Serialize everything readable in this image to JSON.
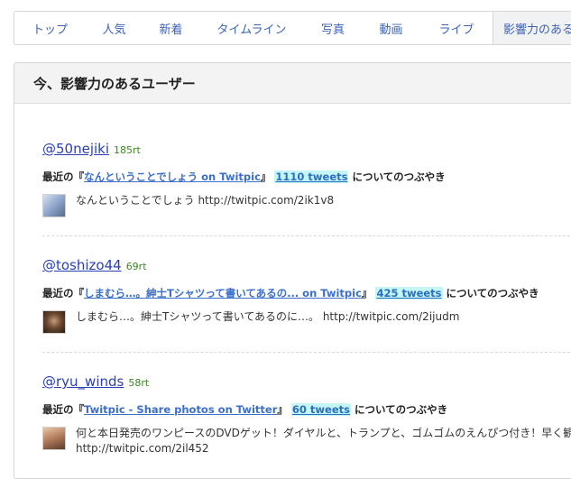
{
  "tabs": [
    {
      "label": "トップ"
    },
    {
      "label": "人気"
    },
    {
      "label": "新着"
    },
    {
      "label": "タイムライン"
    },
    {
      "label": "写真"
    },
    {
      "label": "動画"
    },
    {
      "label": "ライブ"
    },
    {
      "label": "影響力のある"
    }
  ],
  "section": {
    "title": "今、影響力のあるユーザー"
  },
  "labels": {
    "recent_prefix": "最近の『",
    "recent_mid": "』",
    "recent_suffix": "についてのつぶやき"
  },
  "users": [
    {
      "handle": "@50nejiki",
      "rt": "185rt",
      "topic": "なんということでしょう on Twitpic",
      "count": "1110 tweets",
      "tweet_lines": [
        "なんということでしょう http://twitpic.com/2ik1v8"
      ],
      "avatar_color": "#8aa0c8"
    },
    {
      "handle": "@toshizo44",
      "rt": "69rt",
      "topic": "しまむら…。紳士Tシャツって書いてあるの... on Twitpic",
      "count": "425 tweets",
      "tweet_lines": [
        "しまむら…。紳士Tシャツって書いてあるのに…。 http://twitpic.com/2ijudm"
      ],
      "avatar_color": "#6a4a32"
    },
    {
      "handle": "@ryu_winds",
      "rt": "58rt",
      "topic": "Twitpic - Share photos on Twitter",
      "count": "60 tweets",
      "tweet_lines": [
        "何と本日発売のワンピースのDVDゲット！ダイヤルと、トランプと、ゴムゴムのえんぴつ付き！早く観たい",
        "http://twitpic.com/2il452"
      ],
      "avatar_color": "#b07a5a"
    }
  ]
}
